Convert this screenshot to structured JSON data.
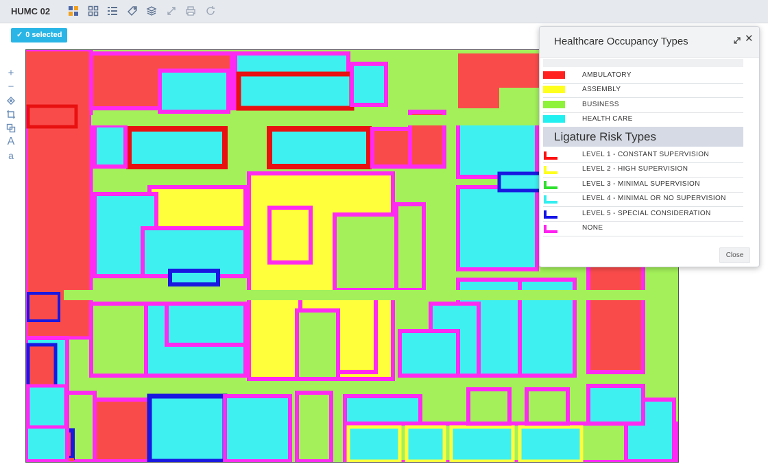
{
  "app": {
    "title": "HUMC 02"
  },
  "toolbar": {
    "icons": [
      "grid-layout-icon",
      "grid-outline-icon",
      "list-icon",
      "tag-icon",
      "layers-icon",
      "expand-icon",
      "print-icon",
      "refresh-icon"
    ]
  },
  "selection": {
    "label": "0 selected"
  },
  "tools": [
    "zoom-in-icon",
    "zoom-out-icon",
    "locate-icon",
    "crop-icon",
    "copy-icon",
    "text-large-icon",
    "text-small-icon"
  ],
  "tool_glyphs": {
    "zoom_in": "+",
    "zoom_out": "−",
    "text_large": "A",
    "text_small": "a"
  },
  "legend_panel": {
    "title": "Healthcare Occupancy Types",
    "occupancy": [
      {
        "label": "AMBULATORY",
        "color": "#ff2020"
      },
      {
        "label": "ASSEMBLY",
        "color": "#ffff1e"
      },
      {
        "label": "BUSINESS",
        "color": "#8ff23a"
      },
      {
        "label": "HEALTH CARE",
        "color": "#22f0f0"
      }
    ],
    "ligature_title": "Ligature Risk Types",
    "ligature": [
      {
        "label": "LEVEL 1 - CONSTANT SUPERVISION",
        "color": "#ff1010"
      },
      {
        "label": "LEVEL 2 - HIGH SUPERVISION",
        "color": "#ffff1e"
      },
      {
        "label": "LEVEL 3 - MINIMAL SUPERVISION",
        "color": "#2ee02e"
      },
      {
        "label": "LEVEL 4 - MINIMAL OR NO SUPERVISION",
        "color": "#33eef0"
      },
      {
        "label": "LEVEL 5 - SPECIAL CONSIDERATION",
        "color": "#1414e8"
      },
      {
        "label": "NONE",
        "color": "#ff22f0"
      }
    ],
    "close_label": "Close"
  },
  "colors": {
    "ambulatory": "#fa4b4b",
    "assembly": "#ffff3c",
    "business": "#a3f05a",
    "healthcare": "#3ff0f0",
    "wall_none": "#ff2af2",
    "wall_l1": "#e81010",
    "wall_l5": "#1818e0",
    "accent": "#29b6e6"
  }
}
